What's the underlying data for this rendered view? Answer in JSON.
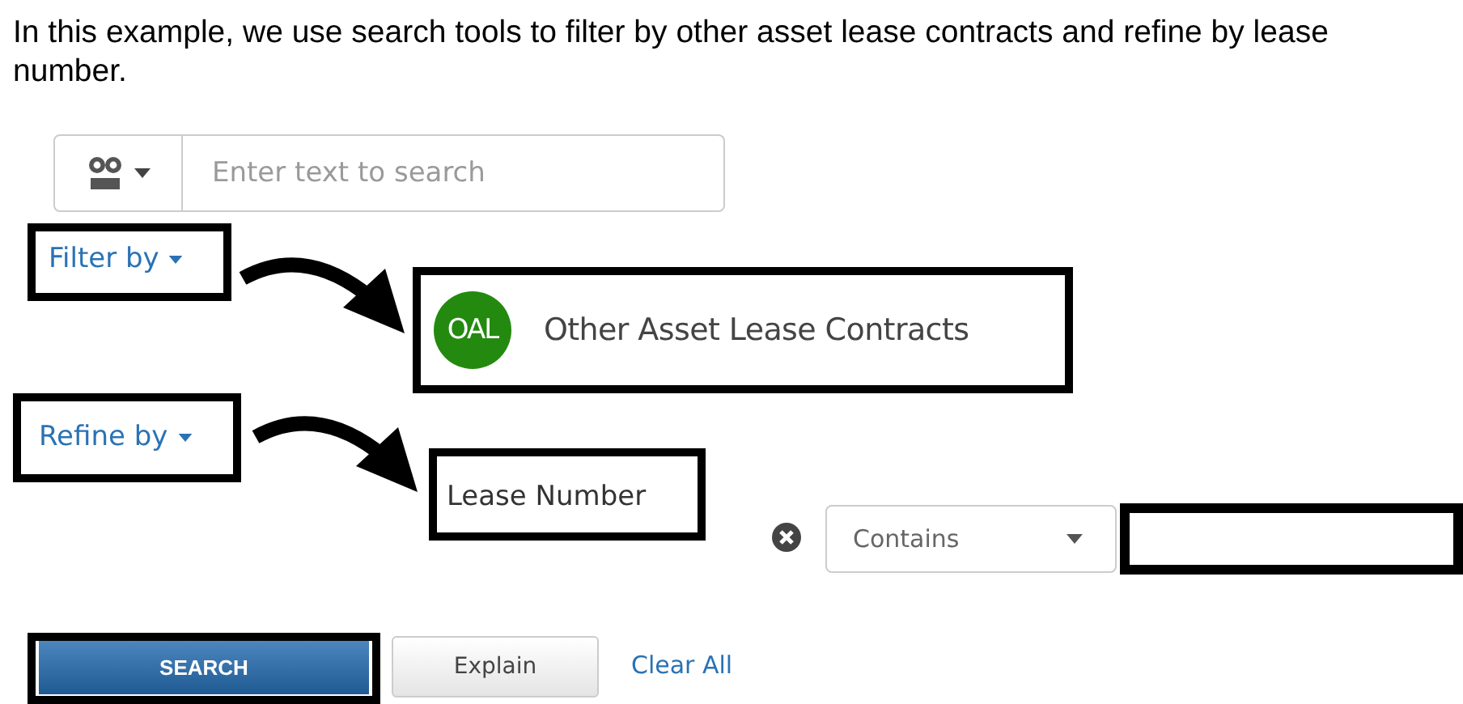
{
  "intro": "In this example, we use search tools to filter by other asset lease contracts and refine by lease number.",
  "search": {
    "placeholder": "Enter text to search"
  },
  "filter": {
    "label": "Filter by",
    "badge": "OAL",
    "result": "Other Asset Lease Contracts"
  },
  "refine": {
    "label": "Refine by",
    "field": "Lease Number",
    "operator": "Contains"
  },
  "buttons": {
    "search": "SEARCH",
    "explain": "Explain",
    "clear": "Clear All"
  }
}
